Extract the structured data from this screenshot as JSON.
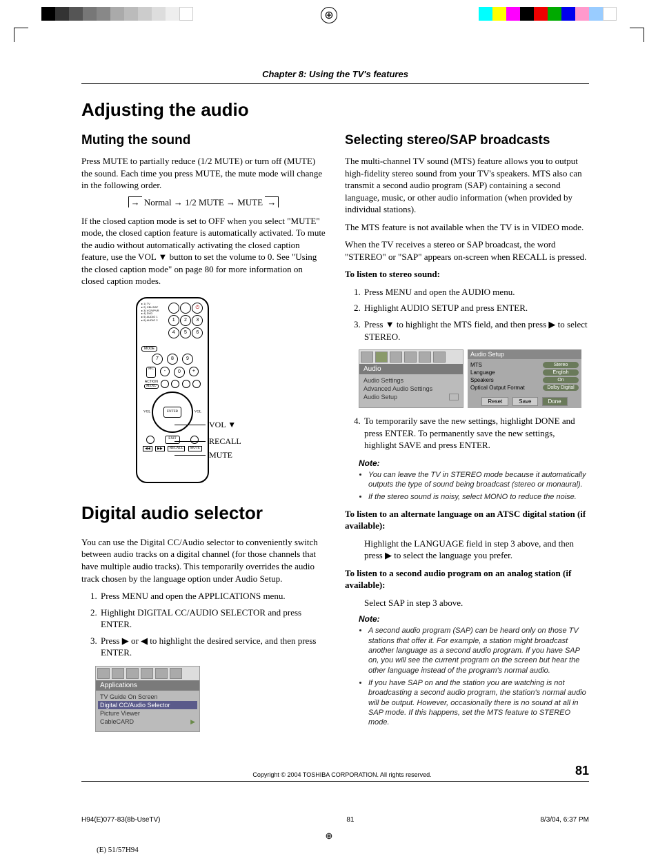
{
  "chapter": "Chapter 8: Using the TV's features",
  "h1_audio": "Adjusting the audio",
  "muting": {
    "heading": "Muting the sound",
    "p1": "Press MUTE to partially reduce (1/2 MUTE) or turn off (MUTE) the sound. Each time you press MUTE, the mute mode will change in the following order.",
    "flow": [
      "Normal",
      "1/2 MUTE",
      "MUTE"
    ],
    "p2": "If the closed caption mode is set to OFF when you select \"MUTE\" mode, the closed caption feature is automatically activated. To mute the audio without automatically activating the closed caption feature, use the VOL ▼ button to set the volume to 0. See \"Using the closed caption mode\" on page 80 for more information on closed caption modes.",
    "callouts": {
      "vol": "VOL ▼",
      "recall": "RECALL",
      "mute": "MUTE"
    }
  },
  "h1_digital": "Digital audio selector",
  "digital": {
    "p1": "You can use the Digital CC/Audio selector to conveniently switch between audio tracks on a digital channel (for those channels that have multiple audio tracks). This temporarily overrides the audio track chosen by the language option under Audio Setup.",
    "steps": [
      "Press MENU and open the APPLICATIONS menu.",
      "Highlight DIGITAL CC/AUDIO SELECTOR and press ENTER.",
      "Press ▶ or ◀ to highlight the desired service, and then press ENTER."
    ],
    "menu": {
      "title": "Applications",
      "items": [
        "TV Guide On Screen",
        "Digital CC/Audio Selector",
        "Picture Viewer",
        "CableCARD"
      ],
      "selected_index": 1
    }
  },
  "stereo": {
    "heading": "Selecting stereo/SAP broadcasts",
    "p1": "The multi-channel TV sound (MTS) feature allows you to output high-fidelity stereo sound from your TV's speakers. MTS also can transmit a second audio program (SAP) containing a second language, music, or other audio information (when provided by individual stations).",
    "p2": "The MTS feature is not available when the TV is in VIDEO mode.",
    "p3": "When the TV receives a stereo or SAP broadcast, the word \"STEREO\" or \"SAP\" appears on-screen when RECALL is pressed.",
    "sub1": "To listen to stereo sound:",
    "steps1": [
      "Press MENU and open the AUDIO menu.",
      "Highlight AUDIO SETUP and press ENTER.",
      "Press ▼ to highlight the MTS field, and then press ▶ to select STEREO."
    ],
    "audio_menu": {
      "title": "Audio",
      "items": [
        "Audio Settings",
        "Advanced Audio Settings",
        "Audio Setup"
      ]
    },
    "setup_menu": {
      "title": "Audio Setup",
      "rows": [
        {
          "label": "MTS",
          "value": "Stereo"
        },
        {
          "label": "Language",
          "value": "English"
        },
        {
          "label": "Speakers",
          "value": "On"
        },
        {
          "label": "Optical Output Format",
          "value": "Dolby Digital"
        }
      ],
      "buttons": [
        "Reset",
        "Save",
        "Done"
      ]
    },
    "step4": "To temporarily save the new settings, highlight DONE and press ENTER. To permanently save the new settings, highlight SAVE and press ENTER.",
    "note1_head": "Note:",
    "note1": [
      "You can leave the TV in STEREO mode because it automatically outputs the type of sound being broadcast (stereo or monaural).",
      "If the stereo sound is noisy, select MONO to reduce the noise."
    ],
    "sub2": "To listen to an alternate language on an ATSC digital station (if available):",
    "p_lang": "Highlight the LANGUAGE field in step 3 above, and then press ▶ to select the language you prefer.",
    "sub3": "To listen to a second audio program on an analog station (if available):",
    "p_sap": "Select SAP in step 3 above.",
    "note2_head": "Note:",
    "note2": [
      "A second audio program (SAP) can be heard only on those TV stations that offer it. For example, a station might broadcast another language as a second audio program. If you have SAP on, you will see the current program on the screen but hear the other language instead of the program's normal audio.",
      "If you have SAP on and the station you are watching is not broadcasting a second audio program, the station's normal audio will be output. However, occasionally there is no sound at all in SAP mode. If this happens, set the MTS feature to STEREO mode."
    ]
  },
  "footer": {
    "copyright": "Copyright © 2004 TOSHIBA CORPORATION. All rights reserved.",
    "pagenum": "81"
  },
  "print": {
    "file": "H94(E)077-83(8b-UseTV)",
    "pg": "81",
    "date": "8/3/04, 6:37 PM",
    "trunc": "(E) 51/57H94"
  }
}
